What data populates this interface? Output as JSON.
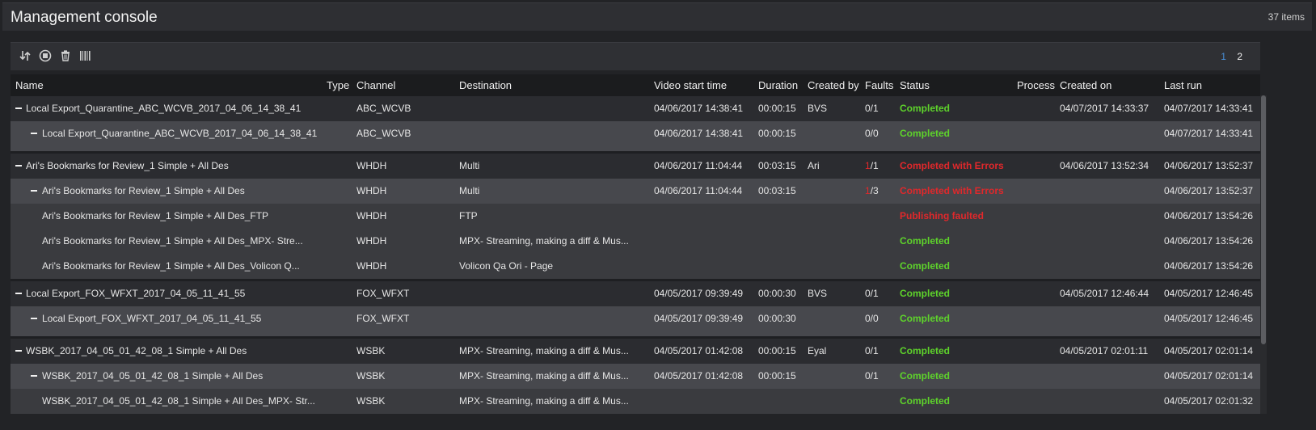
{
  "header": {
    "title": "Management console",
    "item_count": "37 items"
  },
  "toolbar": {
    "icons": [
      "reorder-icon",
      "stop-icon",
      "trash-icon",
      "barcode-icon"
    ],
    "pages": [
      "1",
      "2"
    ],
    "active_page": "1"
  },
  "columns": {
    "name": "Name",
    "type": "Type",
    "channel": "Channel",
    "destination": "Destination",
    "video_start": "Video start time",
    "duration": "Duration",
    "created_by": "Created by",
    "faults": "Faults",
    "status": "Status",
    "process": "Process",
    "created_on": "Created on",
    "last_run": "Last run"
  },
  "rows": [
    {
      "level": 0,
      "name": "Local Export_Quarantine_ABC_WCVB_2017_04_06_14_38_41",
      "channel": "ABC_WCVB",
      "destination": "",
      "video_start": "04/06/2017 14:38:41",
      "duration": "00:00:15",
      "created_by": "BVS",
      "fault_count": "",
      "fault_total": "0/1",
      "status": "Completed",
      "status_kind": "ok",
      "created_on": "04/07/2017 14:33:37",
      "last_run": "04/07/2017 14:33:41"
    },
    {
      "level": 1,
      "name": "Local Export_Quarantine_ABC_WCVB_2017_04_06_14_38_41",
      "channel": "ABC_WCVB",
      "destination": "",
      "video_start": "04/06/2017 14:38:41",
      "duration": "00:00:15",
      "created_by": "",
      "fault_count": "",
      "fault_total": "0/0",
      "status": "Completed",
      "status_kind": "ok",
      "created_on": "",
      "last_run": "04/07/2017 14:33:41"
    },
    {
      "level": 0,
      "name": "Ari's Bookmarks for Review_1 Simple + All Des",
      "channel": "WHDH",
      "destination": "Multi",
      "video_start": "04/06/2017 11:04:44",
      "duration": "00:03:15",
      "created_by": "Ari",
      "fault_count": "1",
      "fault_total": "/1",
      "status": "Completed with Errors",
      "status_kind": "err",
      "created_on": "04/06/2017 13:52:34",
      "last_run": "04/06/2017 13:52:37"
    },
    {
      "level": 1,
      "name": "Ari's Bookmarks for Review_1 Simple + All Des",
      "channel": "WHDH",
      "destination": "Multi",
      "video_start": "04/06/2017 11:04:44",
      "duration": "00:03:15",
      "created_by": "",
      "fault_count": "1",
      "fault_total": "/3",
      "status": "Completed with Errors",
      "status_kind": "err",
      "created_on": "",
      "last_run": "04/06/2017 13:52:37"
    },
    {
      "level": 2,
      "name": "Ari's Bookmarks for Review_1 Simple + All Des_FTP",
      "channel": "WHDH",
      "destination": "FTP",
      "video_start": "",
      "duration": "",
      "created_by": "",
      "fault_count": "",
      "fault_total": "",
      "status": "Publishing faulted",
      "status_kind": "err",
      "created_on": "",
      "last_run": "04/06/2017 13:54:26"
    },
    {
      "level": 2,
      "name": "Ari's Bookmarks for Review_1 Simple + All Des_MPX- Stre...",
      "channel": "WHDH",
      "destination": "MPX- Streaming, making a diff & Mus...",
      "video_start": "",
      "duration": "",
      "created_by": "",
      "fault_count": "",
      "fault_total": "",
      "status": "Completed",
      "status_kind": "ok",
      "created_on": "",
      "last_run": "04/06/2017 13:54:26"
    },
    {
      "level": 2,
      "name": "Ari's Bookmarks for Review_1 Simple + All Des_Volicon Q...",
      "channel": "WHDH",
      "destination": "Volicon Qa Ori - Page",
      "video_start": "",
      "duration": "",
      "created_by": "",
      "fault_count": "",
      "fault_total": "",
      "status": "Completed",
      "status_kind": "ok",
      "created_on": "",
      "last_run": "04/06/2017 13:54:26"
    },
    {
      "level": 0,
      "name": "Local Export_FOX_WFXT_2017_04_05_11_41_55",
      "channel": "FOX_WFXT",
      "destination": "",
      "video_start": "04/05/2017 09:39:49",
      "duration": "00:00:30",
      "created_by": "BVS",
      "fault_count": "",
      "fault_total": "0/1",
      "status": "Completed",
      "status_kind": "ok",
      "created_on": "04/05/2017 12:46:44",
      "last_run": "04/05/2017 12:46:45"
    },
    {
      "level": 1,
      "name": "Local Export_FOX_WFXT_2017_04_05_11_41_55",
      "channel": "FOX_WFXT",
      "destination": "",
      "video_start": "04/05/2017 09:39:49",
      "duration": "00:00:30",
      "created_by": "",
      "fault_count": "",
      "fault_total": "0/0",
      "status": "Completed",
      "status_kind": "ok",
      "created_on": "",
      "last_run": "04/05/2017 12:46:45"
    },
    {
      "level": 0,
      "name": "WSBK_2017_04_05_01_42_08_1 Simple + All Des",
      "channel": "WSBK",
      "destination": "MPX- Streaming, making a diff & Mus...",
      "video_start": "04/05/2017 01:42:08",
      "duration": "00:00:15",
      "created_by": "Eyal",
      "fault_count": "",
      "fault_total": "0/1",
      "status": "Completed",
      "status_kind": "ok",
      "created_on": "04/05/2017 02:01:11",
      "last_run": "04/05/2017 02:01:14"
    },
    {
      "level": 1,
      "name": "WSBK_2017_04_05_01_42_08_1 Simple + All Des",
      "channel": "WSBK",
      "destination": "MPX- Streaming, making a diff & Mus...",
      "video_start": "04/05/2017 01:42:08",
      "duration": "00:00:15",
      "created_by": "",
      "fault_count": "",
      "fault_total": "0/1",
      "status": "Completed",
      "status_kind": "ok",
      "created_on": "",
      "last_run": "04/05/2017 02:01:14"
    },
    {
      "level": 2,
      "name": "WSBK_2017_04_05_01_42_08_1 Simple + All Des_MPX- Str...",
      "channel": "WSBK",
      "destination": "MPX- Streaming, making a diff & Mus...",
      "video_start": "",
      "duration": "",
      "created_by": "",
      "fault_count": "",
      "fault_total": "",
      "status": "Completed",
      "status_kind": "ok",
      "created_on": "",
      "last_run": "04/05/2017 02:01:32"
    }
  ]
}
